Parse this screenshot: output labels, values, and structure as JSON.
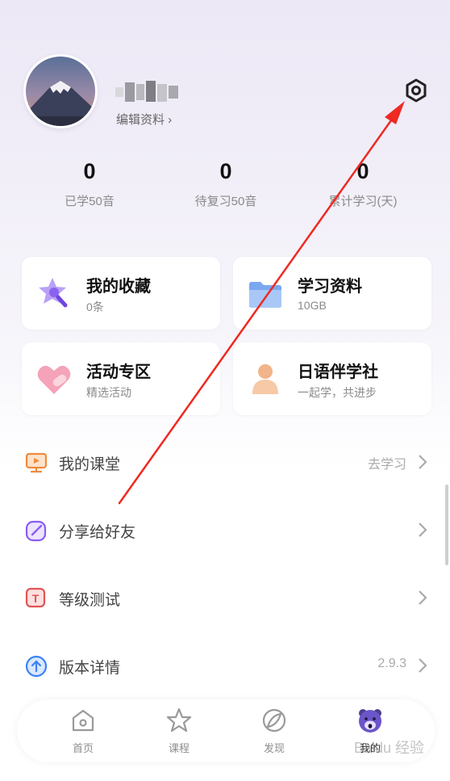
{
  "profile": {
    "edit_label": "编辑资料 ›"
  },
  "stats": [
    {
      "value": "0",
      "label": "已学50音"
    },
    {
      "value": "0",
      "label": "待复习50音"
    },
    {
      "value": "0",
      "label": "累计学习(天)"
    }
  ],
  "cards": [
    {
      "title": "我的收藏",
      "subtitle": "0条",
      "icon": "star-magnifier-icon"
    },
    {
      "title": "学习资料",
      "subtitle": "10GB",
      "icon": "folder-icon"
    },
    {
      "title": "活动专区",
      "subtitle": "精选活动",
      "icon": "heart-icon"
    },
    {
      "title": "日语伴学社",
      "subtitle": "一起学，共进步",
      "icon": "person-icon"
    }
  ],
  "menu": [
    {
      "label": "我的课堂",
      "value": "去学习",
      "icon": "classroom-icon"
    },
    {
      "label": "分享给好友",
      "value": "",
      "icon": "share-icon"
    },
    {
      "label": "等级测试",
      "value": "",
      "icon": "test-icon"
    },
    {
      "label": "版本详情",
      "value": "2.9.3",
      "icon": "version-icon"
    }
  ],
  "tabs": [
    {
      "label": "首页",
      "icon": "home-icon"
    },
    {
      "label": "课程",
      "icon": "star-icon"
    },
    {
      "label": "发现",
      "icon": "discover-icon"
    },
    {
      "label": "我的",
      "icon": "bear-avatar-icon",
      "active": true
    }
  ],
  "colors": {
    "accent": "#7b5cf0",
    "arrow": "#ee2a22",
    "classroom": "#f08a3c",
    "share": "#8b5cf6",
    "test": "#e25555",
    "version": "#3b82f6"
  },
  "watermark": "Baidu 经验"
}
